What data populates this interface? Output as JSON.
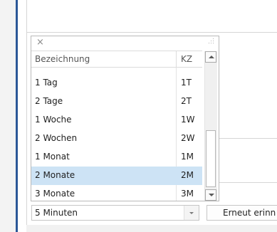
{
  "popup": {
    "close_glyph": "×",
    "header": {
      "col_name": "Bezeichnung",
      "col_code": "KZ"
    },
    "items": [
      {
        "name": "1 Tag",
        "code": "1T",
        "selected": false
      },
      {
        "name": "2 Tage",
        "code": "2T",
        "selected": false
      },
      {
        "name": "1 Woche",
        "code": "1W",
        "selected": false
      },
      {
        "name": "2 Wochen",
        "code": "2W",
        "selected": false
      },
      {
        "name": "1 Monat",
        "code": "1M",
        "selected": false
      },
      {
        "name": "2 Monate",
        "code": "2M",
        "selected": true
      },
      {
        "name": "3 Monate",
        "code": "3M",
        "selected": false
      }
    ]
  },
  "combo": {
    "value": "5 Minuten"
  },
  "remind_button": {
    "label": "Erneut erinn"
  },
  "colors": {
    "selection": "#cde3f5",
    "accent_line": "#2b5797"
  }
}
